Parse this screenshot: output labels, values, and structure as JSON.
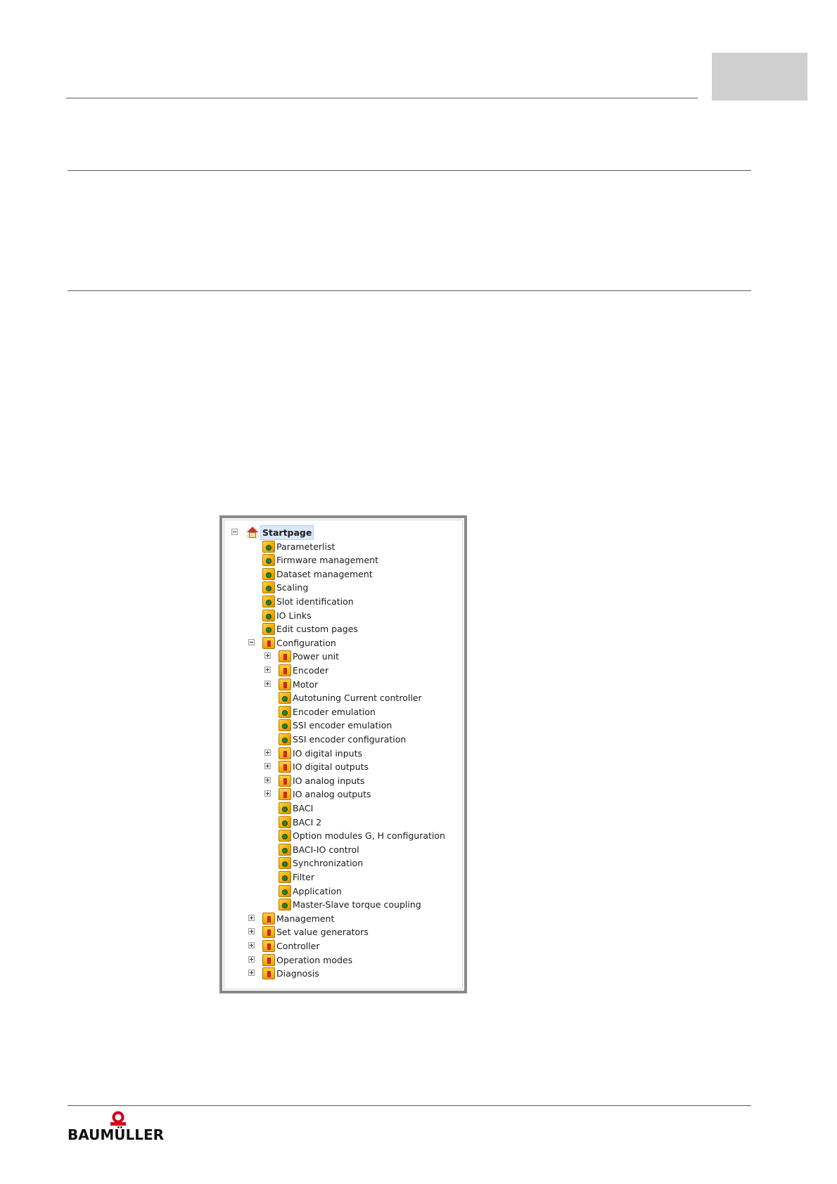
{
  "brand": {
    "logo_text": "BAUMÜLLER",
    "brand_color": "#d0021b"
  },
  "tree": {
    "root": {
      "label": "Startpage",
      "expanded": true,
      "selected": true,
      "icon": "home-icon"
    },
    "items": [
      {
        "label": "Parameterlist",
        "level": 1,
        "kind": "page",
        "icon": "page-icon"
      },
      {
        "label": "Firmware management",
        "level": 1,
        "kind": "page",
        "icon": "page-icon"
      },
      {
        "label": "Dataset management",
        "level": 1,
        "kind": "page",
        "icon": "page-icon"
      },
      {
        "label": "Scaling",
        "level": 1,
        "kind": "page",
        "icon": "page-icon"
      },
      {
        "label": "Slot identification",
        "level": 1,
        "kind": "page",
        "icon": "page-icon"
      },
      {
        "label": "IO Links",
        "level": 1,
        "kind": "page",
        "icon": "page-icon"
      },
      {
        "label": "Edit custom pages",
        "level": 1,
        "kind": "page",
        "icon": "page-icon"
      },
      {
        "label": "Configuration",
        "level": 1,
        "kind": "folder",
        "expander": "minus",
        "icon": "folder-icon"
      },
      {
        "label": "Power unit",
        "level": 2,
        "kind": "folder",
        "expander": "plus",
        "icon": "folder-icon"
      },
      {
        "label": "Encoder",
        "level": 2,
        "kind": "folder",
        "expander": "plus",
        "icon": "folder-icon"
      },
      {
        "label": "Motor",
        "level": 2,
        "kind": "folder",
        "expander": "plus",
        "icon": "folder-icon"
      },
      {
        "label": "Autotuning Current controller",
        "level": 2,
        "kind": "page",
        "icon": "page-icon"
      },
      {
        "label": "Encoder emulation",
        "level": 2,
        "kind": "page",
        "icon": "page-icon"
      },
      {
        "label": "SSI encoder emulation",
        "level": 2,
        "kind": "page",
        "icon": "page-icon"
      },
      {
        "label": "SSI encoder configuration",
        "level": 2,
        "kind": "page",
        "icon": "page-icon"
      },
      {
        "label": "IO digital inputs",
        "level": 2,
        "kind": "folder",
        "expander": "plus",
        "icon": "folder-icon"
      },
      {
        "label": "IO digital outputs",
        "level": 2,
        "kind": "folder",
        "expander": "plus",
        "icon": "folder-icon"
      },
      {
        "label": "IO analog inputs",
        "level": 2,
        "kind": "folder",
        "expander": "plus",
        "icon": "folder-icon"
      },
      {
        "label": "IO analog outputs",
        "level": 2,
        "kind": "folder",
        "expander": "plus",
        "icon": "folder-icon"
      },
      {
        "label": "BACI",
        "level": 2,
        "kind": "page",
        "icon": "page-icon"
      },
      {
        "label": "BACI 2",
        "level": 2,
        "kind": "page",
        "icon": "page-icon"
      },
      {
        "label": "Option modules G, H configuration",
        "level": 2,
        "kind": "page",
        "icon": "page-icon"
      },
      {
        "label": "BACI-IO control",
        "level": 2,
        "kind": "page",
        "icon": "page-icon"
      },
      {
        "label": "Synchronization",
        "level": 2,
        "kind": "page",
        "icon": "page-icon"
      },
      {
        "label": "Filter",
        "level": 2,
        "kind": "page",
        "icon": "page-icon"
      },
      {
        "label": "Application",
        "level": 2,
        "kind": "page",
        "icon": "page-icon"
      },
      {
        "label": "Master-Slave torque coupling",
        "level": 2,
        "kind": "page",
        "icon": "page-icon"
      },
      {
        "label": "Management",
        "level": 1,
        "kind": "folder",
        "expander": "plus",
        "icon": "folder-icon"
      },
      {
        "label": "Set value generators",
        "level": 1,
        "kind": "folder",
        "expander": "plus",
        "icon": "folder-icon"
      },
      {
        "label": "Controller",
        "level": 1,
        "kind": "folder",
        "expander": "plus",
        "icon": "folder-icon"
      },
      {
        "label": "Operation modes",
        "level": 1,
        "kind": "folder",
        "expander": "plus",
        "icon": "folder-icon"
      },
      {
        "label": "Diagnosis",
        "level": 1,
        "kind": "folder",
        "expander": "plus",
        "icon": "folder-icon"
      }
    ]
  }
}
